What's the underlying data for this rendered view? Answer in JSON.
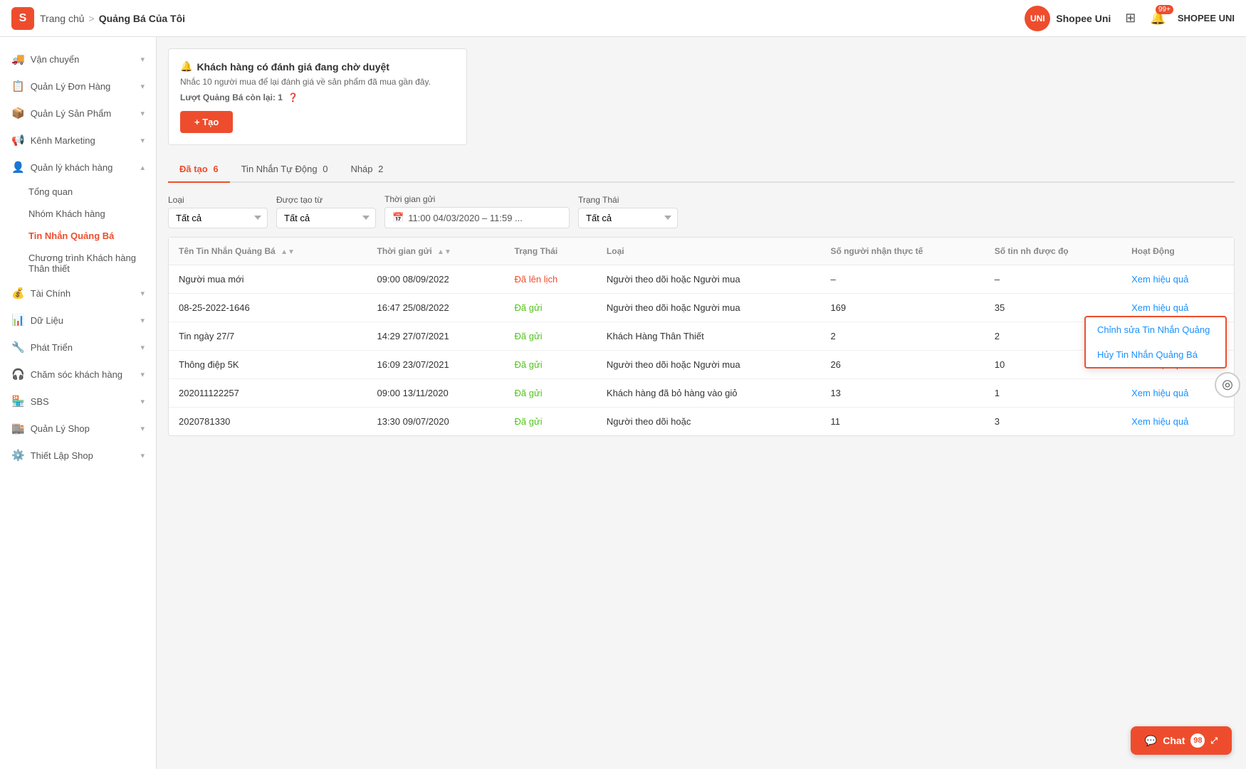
{
  "header": {
    "logo_text": "S",
    "breadcrumb_home": "Trang chủ",
    "breadcrumb_sep": ">",
    "breadcrumb_current": "Quảng Bá Của Tôi",
    "shopee_uni_label": "Shopee Uni",
    "badge_notification": "99+",
    "user_name": "SHOPEE UNI"
  },
  "sidebar": {
    "items": [
      {
        "id": "van-chuyen",
        "icon": "🚚",
        "label": "Vận chuyển",
        "has_sub": true
      },
      {
        "id": "quan-ly-don-hang",
        "icon": "📋",
        "label": "Quản Lý Đơn Hàng",
        "has_sub": true
      },
      {
        "id": "quan-ly-san-pham",
        "icon": "📦",
        "label": "Quản Lý Sản Phẩm",
        "has_sub": true
      },
      {
        "id": "kenh-marketing",
        "icon": "📢",
        "label": "Kênh Marketing",
        "has_sub": true
      },
      {
        "id": "quan-ly-khach-hang",
        "icon": "👤",
        "label": "Quản lý khách hàng",
        "has_sub": true,
        "expanded": true,
        "sub_items": [
          {
            "id": "tong-quan",
            "label": "Tổng quan",
            "active": false
          },
          {
            "id": "nhom-khach-hang",
            "label": "Nhóm Khách hàng",
            "active": false
          },
          {
            "id": "tin-nhan-quang-ba",
            "label": "Tin Nhắn Quảng Bá",
            "active": true
          },
          {
            "id": "chuong-trinh-khach-hang",
            "label": "Chương trình Khách hàng Thân thiết",
            "active": false
          }
        ]
      },
      {
        "id": "tai-chinh",
        "icon": "💰",
        "label": "Tài Chính",
        "has_sub": true
      },
      {
        "id": "du-lieu",
        "icon": "📊",
        "label": "Dữ Liệu",
        "has_sub": true
      },
      {
        "id": "phat-trien",
        "icon": "🔧",
        "label": "Phát Triển",
        "has_sub": true
      },
      {
        "id": "cham-soc-khach-hang",
        "icon": "🎧",
        "label": "Chăm sóc khách hàng",
        "has_sub": true
      },
      {
        "id": "sbs",
        "icon": "🏪",
        "label": "SBS",
        "has_sub": true
      },
      {
        "id": "quan-ly-shop",
        "icon": "🏬",
        "label": "Quản Lý Shop",
        "has_sub": true
      },
      {
        "id": "thiet-lap-shop",
        "icon": "⚙️",
        "label": "Thiết Lập Shop",
        "has_sub": true
      }
    ]
  },
  "alert": {
    "icon": "🔔",
    "title": "Khách hàng có đánh giá đang chờ duyệt",
    "description": "Nhắc 10 người mua để lại đánh giá về sản phẩm đã mua gần đây.",
    "remain_label": "Lượt Quảng Bá còn lại:",
    "remain_value": "1",
    "create_btn": "+ Tạo"
  },
  "tabs": [
    {
      "id": "da-tao",
      "label": "Đã tạo",
      "count": "6",
      "active": true
    },
    {
      "id": "tin-nhan-tu-dong",
      "label": "Tin Nhắn Tự Động",
      "count": "0",
      "active": false
    },
    {
      "id": "nhap",
      "label": "Nháp",
      "count": "2",
      "active": false
    }
  ],
  "filters": {
    "loai_label": "Loại",
    "loai_value": "Tất cả",
    "duoc_tao_tu_label": "Được tạo từ",
    "duoc_tao_tu_value": "Tất cả",
    "thoi_gian_gui_label": "Thời gian gửi",
    "thoi_gian_gui_value": "11:00 04/03/2020 – 11:59 ...",
    "trang_thai_label": "Trạng Thái",
    "trang_thai_value": "Tất cả"
  },
  "table": {
    "columns": [
      {
        "id": "ten",
        "label": "Tên Tin Nhắn Quảng Bá",
        "sortable": true
      },
      {
        "id": "thoi_gian",
        "label": "Thời gian gửi",
        "sortable": true
      },
      {
        "id": "trang_thai",
        "label": "Trạng Thái",
        "sortable": false
      },
      {
        "id": "loai",
        "label": "Loại",
        "sortable": false
      },
      {
        "id": "so_nguoi_nhan",
        "label": "Số người nhận thực tế",
        "sortable": false
      },
      {
        "id": "so_tin",
        "label": "Số tin nh được đọ",
        "sortable": false
      },
      {
        "id": "hoat_dong",
        "label": "Hoạt Động",
        "sortable": false
      }
    ],
    "rows": [
      {
        "id": "row-1",
        "ten": "Người mua mới",
        "thoi_gian": "09:00 08/09/2022",
        "trang_thai": "Đã lên lịch",
        "trang_thai_class": "scheduled",
        "loai": "Người theo dõi hoặc Người mua",
        "so_nguoi_nhan": "–",
        "so_tin": "–",
        "hoat_dong": "Xem hiệu quả",
        "show_dropdown": true
      },
      {
        "id": "row-2",
        "ten": "08-25-2022-1646",
        "thoi_gian": "16:47 25/08/2022",
        "trang_thai": "Đã gửi",
        "trang_thai_class": "sent",
        "loai": "Người theo dõi hoặc Người mua",
        "so_nguoi_nhan": "169",
        "so_tin": "35",
        "hoat_dong": "Xem hiệu quả",
        "show_dropdown": false
      },
      {
        "id": "row-3",
        "ten": "Tin ngày 27/7",
        "thoi_gian": "14:29 27/07/2021",
        "trang_thai": "Đã gửi",
        "trang_thai_class": "sent",
        "loai": "Khách Hàng Thân Thiết",
        "so_nguoi_nhan": "2",
        "so_tin": "2",
        "hoat_dong": "Xem hiệu quả",
        "show_dropdown": false
      },
      {
        "id": "row-4",
        "ten": "Thông điệp 5K",
        "thoi_gian": "16:09 23/07/2021",
        "trang_thai": "Đã gửi",
        "trang_thai_class": "sent",
        "loai": "Người theo dõi hoặc Người mua",
        "so_nguoi_nhan": "26",
        "so_tin": "10",
        "hoat_dong": "Xem hiệu quả",
        "show_dropdown": false
      },
      {
        "id": "row-5",
        "ten": "202011122257",
        "thoi_gian": "09:00 13/11/2020",
        "trang_thai": "Đã gửi",
        "trang_thai_class": "sent",
        "loai": "Khách hàng đã bỏ hàng vào giỏ",
        "so_nguoi_nhan": "13",
        "so_tin": "1",
        "hoat_dong": "Xem hiệu quả",
        "show_dropdown": false
      },
      {
        "id": "row-6",
        "ten": "2020781330",
        "thoi_gian": "13:30 09/07/2020",
        "trang_thai": "Đã gửi",
        "trang_thai_class": "sent",
        "loai": "Người theo dõi hoặc",
        "so_nguoi_nhan": "11",
        "so_tin": "3",
        "hoat_dong": "Xem hiệu quả",
        "show_dropdown": false
      }
    ],
    "dropdown": {
      "edit_label": "Chỉnh sửa Tin Nhắn Quảng",
      "cancel_label": "Hủy Tin Nhắn Quảng Bá"
    }
  },
  "chat": {
    "label": "Chat",
    "badge": "98"
  }
}
